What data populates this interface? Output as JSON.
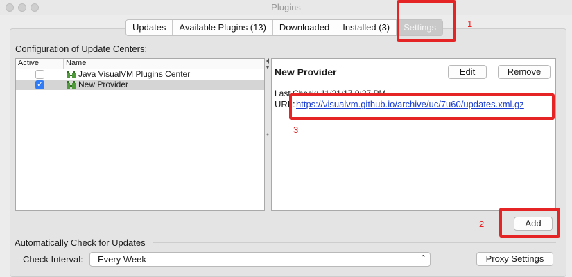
{
  "window": {
    "title": "Plugins"
  },
  "tabs": [
    {
      "label": "Updates"
    },
    {
      "label": "Available Plugins (13)"
    },
    {
      "label": "Downloaded"
    },
    {
      "label": "Installed (3)"
    },
    {
      "label": "Settings",
      "active": true
    }
  ],
  "config": {
    "label": "Configuration of Update Centers:"
  },
  "table": {
    "columns": [
      "Active",
      "Name"
    ],
    "rows": [
      {
        "active": false,
        "name": "Java VisualVM Plugins Center",
        "icon": "plugin-icon"
      },
      {
        "active": true,
        "name": "New Provider",
        "icon": "plugin-icon",
        "selected": true
      }
    ]
  },
  "details": {
    "title": "New Provider",
    "edit_label": "Edit",
    "remove_label": "Remove",
    "last_check": "Last Check: 11/21/17 9:37 PM",
    "url_label": "URL:",
    "url": "https://visualvm.github.io/archive/uc/7u60/updates.xml.gz"
  },
  "add_label": "Add",
  "annotations": {
    "one": "1",
    "two": "2",
    "three": "3",
    "color": "#e52525"
  },
  "auto_check": {
    "label": "Automatically Check for Updates",
    "interval_label": "Check Interval:",
    "interval_value": "Every Week",
    "proxy_label": "Proxy Settings"
  }
}
